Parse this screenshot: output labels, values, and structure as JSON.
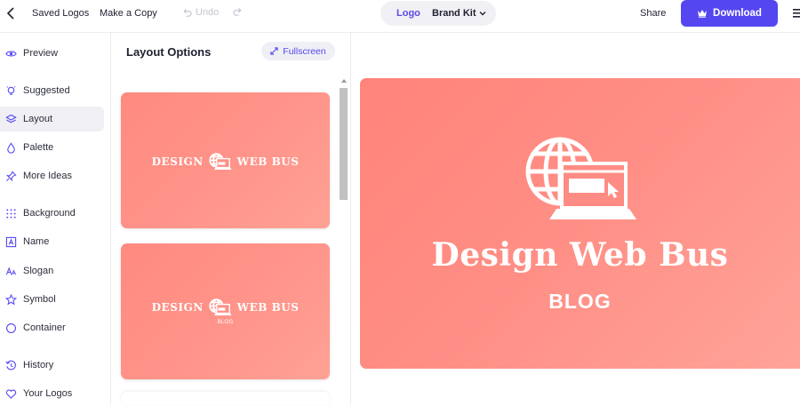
{
  "topbar": {
    "saved_logos": "Saved Logos",
    "make_copy": "Make a Copy",
    "undo": "Undo",
    "logo_tab": "Logo",
    "brand_kit_tab": "Brand Kit",
    "share": "Share",
    "download": "Download"
  },
  "sidebar": {
    "items": [
      {
        "label": "Preview",
        "icon": "eye-icon"
      },
      {
        "label": "Suggested",
        "icon": "bulb-icon"
      },
      {
        "label": "Layout",
        "icon": "layers-icon"
      },
      {
        "label": "Palette",
        "icon": "drop-icon"
      },
      {
        "label": "More Ideas",
        "icon": "pin-icon"
      },
      {
        "label": "Background",
        "icon": "dots-grid-icon"
      },
      {
        "label": "Name",
        "icon": "name-icon"
      },
      {
        "label": "Slogan",
        "icon": "slogan-icon"
      },
      {
        "label": "Symbol",
        "icon": "star-icon"
      },
      {
        "label": "Container",
        "icon": "circle-icon"
      },
      {
        "label": "History",
        "icon": "history-icon"
      },
      {
        "label": "Your Logos",
        "icon": "heart-icon"
      }
    ],
    "active": "Layout"
  },
  "panel": {
    "title": "Layout Options",
    "fullscreen": "Fullscreen",
    "cards": [
      {
        "name": "DESIGN WEB BUS",
        "tagline": ""
      },
      {
        "name": "DESIGN WEB BUS",
        "tagline": "BLOG"
      }
    ]
  },
  "preview": {
    "name": "Design Web Bus",
    "tagline": "BLOG",
    "bg_color": "#ff8a80"
  },
  "colors": {
    "accent": "#5547f0",
    "logo_bg": "#ff8a80"
  }
}
